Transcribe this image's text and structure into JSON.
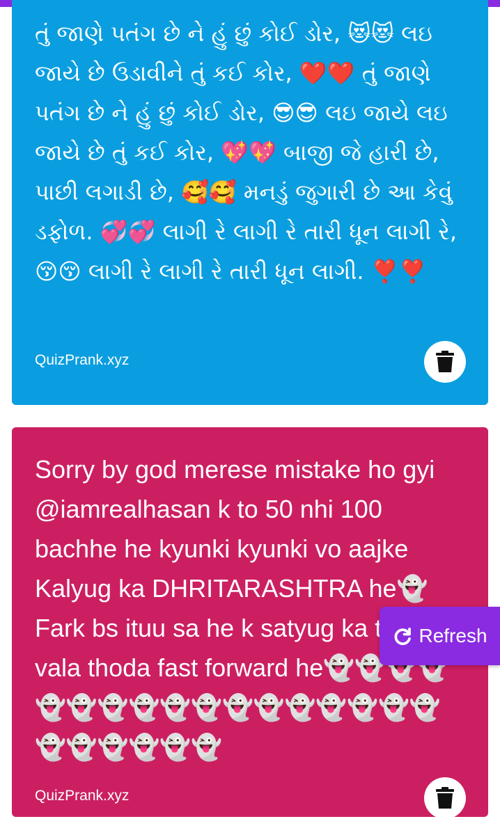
{
  "colors": {
    "accent": "#8a2be2",
    "card_blue": "#0a9ee0",
    "card_pink": "#cc1f62",
    "text": "#ffffff"
  },
  "cards": [
    {
      "message": "તું જાણે પતંગ છે ને હું છું કોઈ ડોર, 😻😻 લઇ જાયે છે ઉડાવીને તું કઈ કોર, ❤️❤️ તું જાણે પતંગ છે ને હું છું કોઈ ડોર, 😎😎 લઇ જાયે લઇ જાયે છે તું કઈ કોર, 💖💖 બાજી જે હારી છે, પાછી લગાડી છે, 🥰🥰 મનડું જુગારી છે આ કેવું ડફોળ. 💞💞 લાગી રે લાગી રે તારી ધૂન લાગી રે, 😚😚 લાગી રે લાગી રે તારી ધૂન લાગી. ❣️❣️",
      "footer": "QuizPrank.xyz",
      "delete_icon": "trash-icon"
    },
    {
      "message": "Sorry by god merese mistake ho gyi @iamrealhasan k to 50 nhi 100 bachhe he kyunki kyunki vo aajke Kalyug ka DHRITARASHTRA he👻 Fark bs ituu sa he k satyug ka tha ye vala thoda fast forward he👻👻👻👻👻👻👻👻👻👻👻👻👻👻👻👻👻👻👻👻👻👻👻",
      "footer": "QuizPrank.xyz",
      "delete_icon": "trash-icon"
    }
  ],
  "refresh": {
    "label": "Refresh",
    "icon": "redo-icon"
  }
}
